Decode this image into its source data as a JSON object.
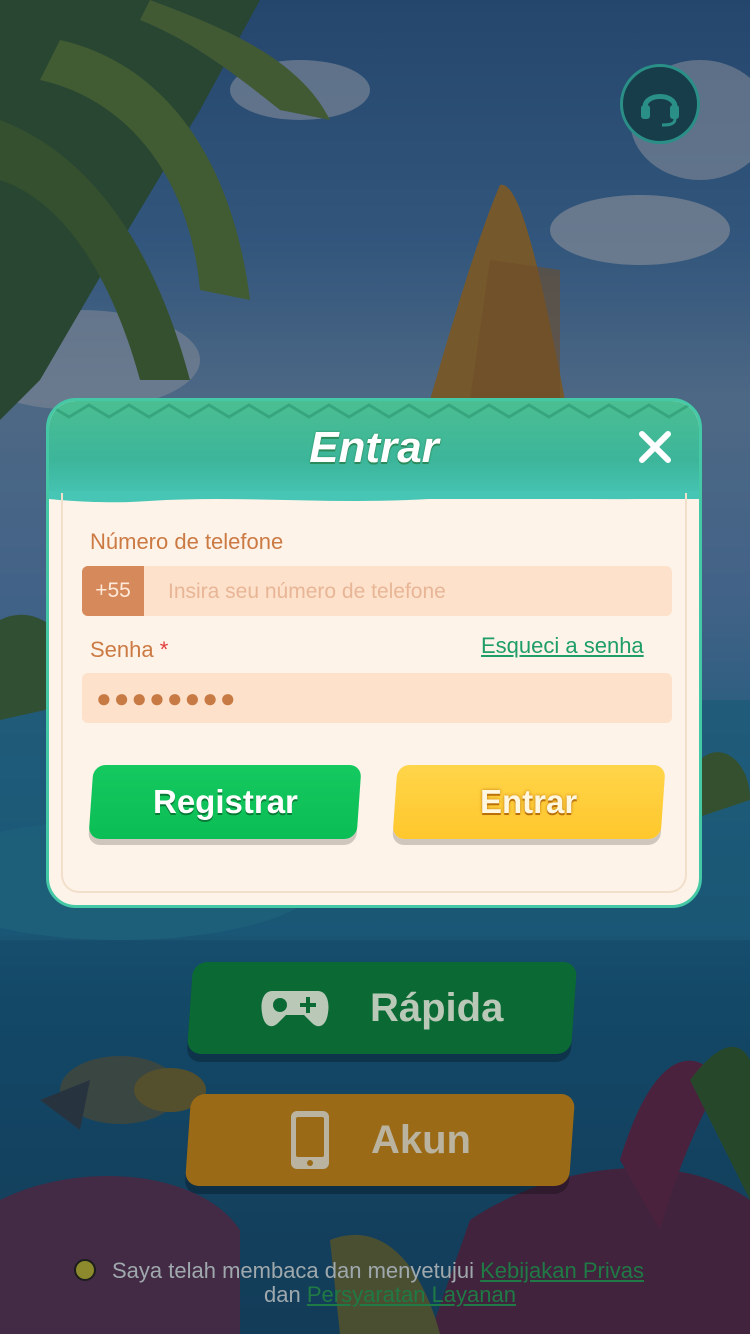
{
  "modal": {
    "title": "Entrar",
    "phone_label": "Número de telefone",
    "country_code": "+55",
    "phone_placeholder": "Insira seu número de telefone",
    "password_label": "Senha",
    "required_mark": "*",
    "forgot_password": "Esqueci a senha",
    "password_mask": "●●●●●●●●",
    "register_button": "Registrar",
    "login_button": "Entrar"
  },
  "background_menu": {
    "quick_button": "Rápida",
    "account_button": "Akun"
  },
  "consent": {
    "text": "Saya telah membaca dan menyetujui",
    "privacy_link": "Kebijakan Privas",
    "conjunction": "dan",
    "terms_link": "Persyaratan Layanan"
  },
  "colors": {
    "header_green": "#3cb59a",
    "register_green": "#0bbd55",
    "login_yellow": "#ffc72c",
    "label_orange": "#cc7a44",
    "link_green": "#1f9e6a"
  }
}
